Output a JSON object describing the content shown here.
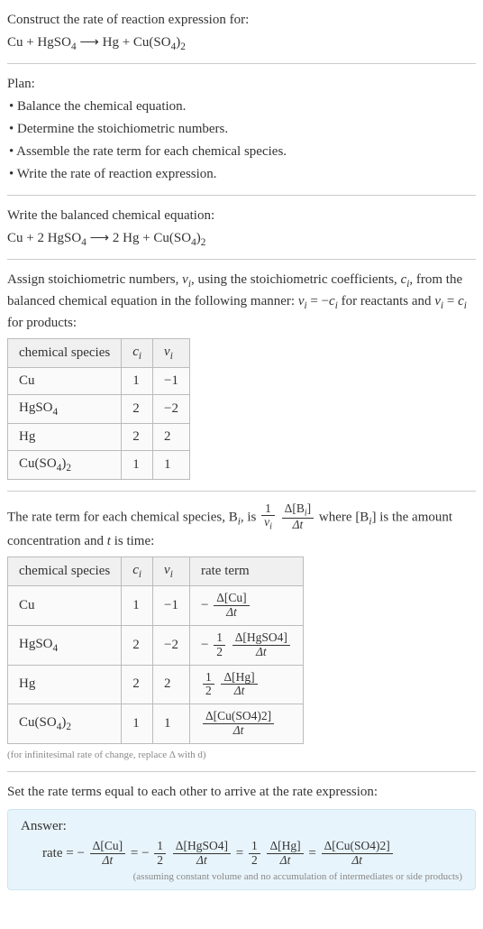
{
  "intro": {
    "prompt": "Construct the rate of reaction expression for:",
    "eq_lhs1": "Cu + HgSO",
    "eq_sub1": "4",
    "eq_arrow": " ⟶ ",
    "eq_rhs1": "Hg + Cu(SO",
    "eq_rhs_sub1": "4",
    "eq_rhs2": ")",
    "eq_rhs_sub2": "2"
  },
  "plan": {
    "heading": "Plan:",
    "b1": "• Balance the chemical equation.",
    "b2": "• Determine the stoichiometric numbers.",
    "b3": "• Assemble the rate term for each chemical species.",
    "b4": "• Write the rate of reaction expression."
  },
  "balanced": {
    "heading": "Write the balanced chemical equation:",
    "eq_l1": "Cu + 2 HgSO",
    "eq_l1_sub": "4",
    "eq_arrow": " ⟶ ",
    "eq_r1": "2 Hg + Cu(SO",
    "eq_r1_sub": "4",
    "eq_r2": ")",
    "eq_r2_sub": "2"
  },
  "stoich": {
    "text_a": "Assign stoichiometric numbers, ",
    "nu_i": "ν",
    "i_sub": "i",
    "text_b": ", using the stoichiometric coefficients, ",
    "c_i": "c",
    "text_c": ", from the balanced chemical equation in the following manner: ",
    "eq1_l": "ν",
    "eq1_eq": " = −",
    "eq1_r": "c",
    "text_d": " for reactants and ",
    "eq2_l": "ν",
    "eq2_eq": " = ",
    "eq2_r": "c",
    "text_e": " for products:"
  },
  "table1": {
    "h1": "chemical species",
    "h2": "c",
    "h2_sub": "i",
    "h3": "ν",
    "h3_sub": "i",
    "rows": [
      {
        "sp_a": "Cu",
        "sp_b": "",
        "c": "1",
        "v": "−1"
      },
      {
        "sp_a": "HgSO",
        "sp_b": "4",
        "c": "2",
        "v": "−2"
      },
      {
        "sp_a": "Hg",
        "sp_b": "",
        "c": "2",
        "v": "2"
      },
      {
        "sp_a": "Cu(SO",
        "sp_b": "4",
        "sp_c": ")",
        "sp_d": "2",
        "c": "1",
        "v": "1"
      }
    ]
  },
  "rateterm": {
    "text_a": "The rate term for each chemical species, B",
    "i_sub": "i",
    "text_b": ", is ",
    "frac1_num": "1",
    "frac1_den_a": "ν",
    "frac1_den_b": "i",
    "frac2_num_a": "Δ[B",
    "frac2_num_b": "i",
    "frac2_num_c": "]",
    "frac2_den": "Δt",
    "text_c": " where [B",
    "text_d": "] is the amount concentration and ",
    "t": "t",
    "text_e": " is time:"
  },
  "table2": {
    "h1": "chemical species",
    "h2": "c",
    "h2_sub": "i",
    "h3": "ν",
    "h3_sub": "i",
    "h4": "rate term",
    "rows": [
      {
        "sp_a": "Cu",
        "sp_b": "",
        "c": "1",
        "v": "−1",
        "rt_pre": "−",
        "rt_num": "Δ[Cu]",
        "rt_den": "Δt",
        "rt_half": false
      },
      {
        "sp_a": "HgSO",
        "sp_b": "4",
        "c": "2",
        "v": "−2",
        "rt_pre": "−",
        "rt_num": "Δ[HgSO4]",
        "rt_den": "Δt",
        "rt_half": true
      },
      {
        "sp_a": "Hg",
        "sp_b": "",
        "c": "2",
        "v": "2",
        "rt_pre": "",
        "rt_num": "Δ[Hg]",
        "rt_den": "Δt",
        "rt_half": true
      },
      {
        "sp_a": "Cu(SO",
        "sp_b": "4",
        "sp_c": ")",
        "sp_d": "2",
        "c": "1",
        "v": "1",
        "rt_pre": "",
        "rt_num": "Δ[Cu(SO4)2]",
        "rt_den": "Δt",
        "rt_half": false
      }
    ],
    "half_num": "1",
    "half_den": "2"
  },
  "note1": "(for infinitesimal rate of change, replace Δ with d)",
  "final": {
    "heading": "Set the rate terms equal to each other to arrive at the rate expression:"
  },
  "answer": {
    "label": "Answer:",
    "rate": "rate = ",
    "neg": "−",
    "eq": " = ",
    "t1_num": "Δ[Cu]",
    "t1_den": "Δt",
    "half_num": "1",
    "half_den": "2",
    "t2_num": "Δ[HgSO4]",
    "t2_den": "Δt",
    "t3_num": "Δ[Hg]",
    "t3_den": "Δt",
    "t4_num": "Δ[Cu(SO4)2]",
    "t4_den": "Δt",
    "note": "(assuming constant volume and no accumulation of intermediates or side products)"
  },
  "chart_data": {
    "type": "table",
    "tables": [
      {
        "title": "Stoichiometric numbers",
        "columns": [
          "chemical species",
          "c_i",
          "ν_i"
        ],
        "rows": [
          [
            "Cu",
            1,
            -1
          ],
          [
            "HgSO4",
            2,
            -2
          ],
          [
            "Hg",
            2,
            2
          ],
          [
            "Cu(SO4)2",
            1,
            1
          ]
        ]
      },
      {
        "title": "Rate terms",
        "columns": [
          "chemical species",
          "c_i",
          "ν_i",
          "rate term"
        ],
        "rows": [
          [
            "Cu",
            1,
            -1,
            "-Δ[Cu]/Δt"
          ],
          [
            "HgSO4",
            2,
            -2,
            "-(1/2) Δ[HgSO4]/Δt"
          ],
          [
            "Hg",
            2,
            2,
            "(1/2) Δ[Hg]/Δt"
          ],
          [
            "Cu(SO4)2",
            1,
            1,
            "Δ[Cu(SO4)2]/Δt"
          ]
        ]
      }
    ],
    "rate_expression": "rate = -Δ[Cu]/Δt = -(1/2) Δ[HgSO4]/Δt = (1/2) Δ[Hg]/Δt = Δ[Cu(SO4)2]/Δt"
  }
}
